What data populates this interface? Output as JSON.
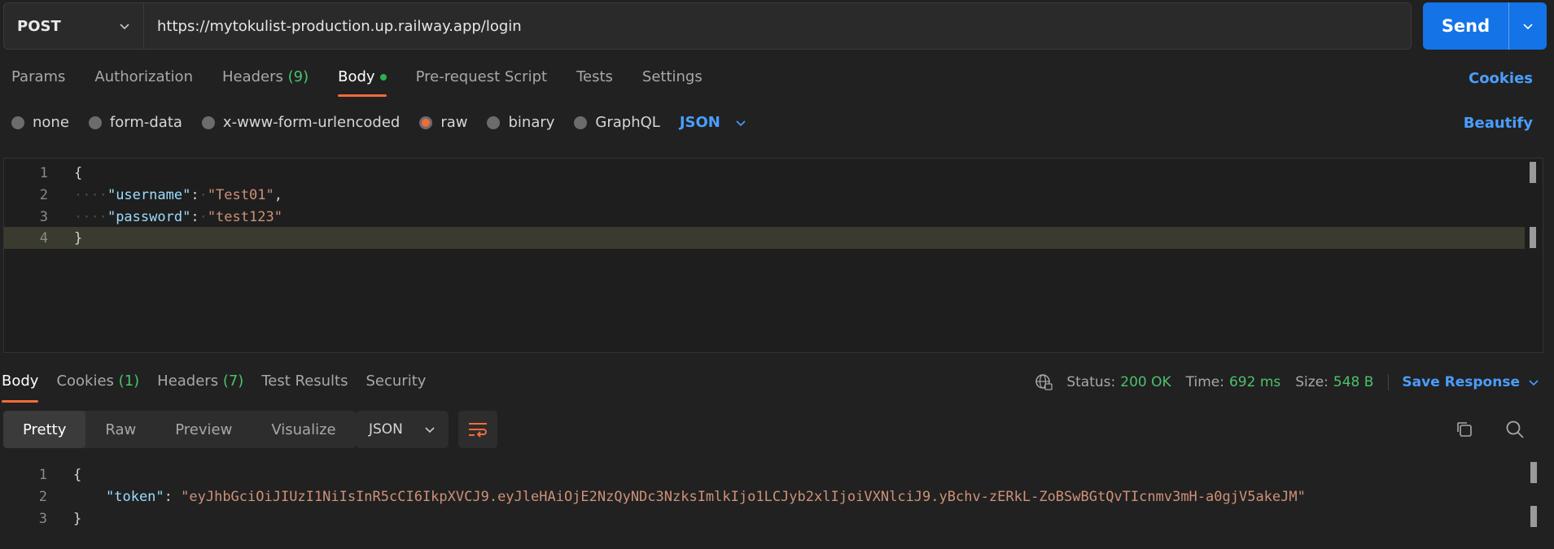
{
  "request": {
    "method": "POST",
    "url": "https://mytokulist-production.up.railway.app/login",
    "send_label": "Send"
  },
  "request_tabs": [
    {
      "label": "Params"
    },
    {
      "label": "Authorization"
    },
    {
      "label": "Headers",
      "count": "(9)"
    },
    {
      "label": "Body"
    },
    {
      "label": "Pre-request Script"
    },
    {
      "label": "Tests"
    },
    {
      "label": "Settings"
    }
  ],
  "cookies_label": "Cookies",
  "body_types": [
    "none",
    "form-data",
    "x-www-form-urlencoded",
    "raw",
    "binary",
    "GraphQL"
  ],
  "body_format": "JSON",
  "beautify_label": "Beautify",
  "request_body": {
    "line_numbers": [
      "1",
      "2",
      "3",
      "4"
    ],
    "open_brace": "{",
    "close_brace": "}",
    "username_key": "\"username\"",
    "username_value": "\"Test01\"",
    "password_key": "\"password\"",
    "password_value": "\"test123\""
  },
  "response_tabs": [
    {
      "label": "Body"
    },
    {
      "label": "Cookies",
      "count": "(1)"
    },
    {
      "label": "Headers",
      "count": "(7)"
    },
    {
      "label": "Test Results"
    },
    {
      "label": "Security"
    }
  ],
  "response_meta": {
    "status_label": "Status:",
    "status_value": "200 OK",
    "time_label": "Time:",
    "time_value": "692 ms",
    "size_label": "Size:",
    "size_value": "548 B",
    "save_label": "Save Response"
  },
  "view_modes": [
    "Pretty",
    "Raw",
    "Preview",
    "Visualize"
  ],
  "response_format": "JSON",
  "response_body": {
    "line_numbers": [
      "1",
      "2",
      "3"
    ],
    "open_brace": "{",
    "close_brace": "}",
    "token_key": "\"token\"",
    "token_value": "\"eyJhbGciOiJIUzI1NiIsInR5cCI6IkpXVCJ9.eyJleHAiOjE2NzQyNDc3NzksImlkIjo1LCJyb2xlIjoiVXNlciJ9.yBchv-zERkL-ZoBSwBGtQvTIcnmv3mH-a0gjV5akeJM\""
  },
  "colors": {
    "accent": "#f26b3a",
    "link": "#4a9eff",
    "success": "#4cc26b",
    "send": "#1473e6"
  }
}
